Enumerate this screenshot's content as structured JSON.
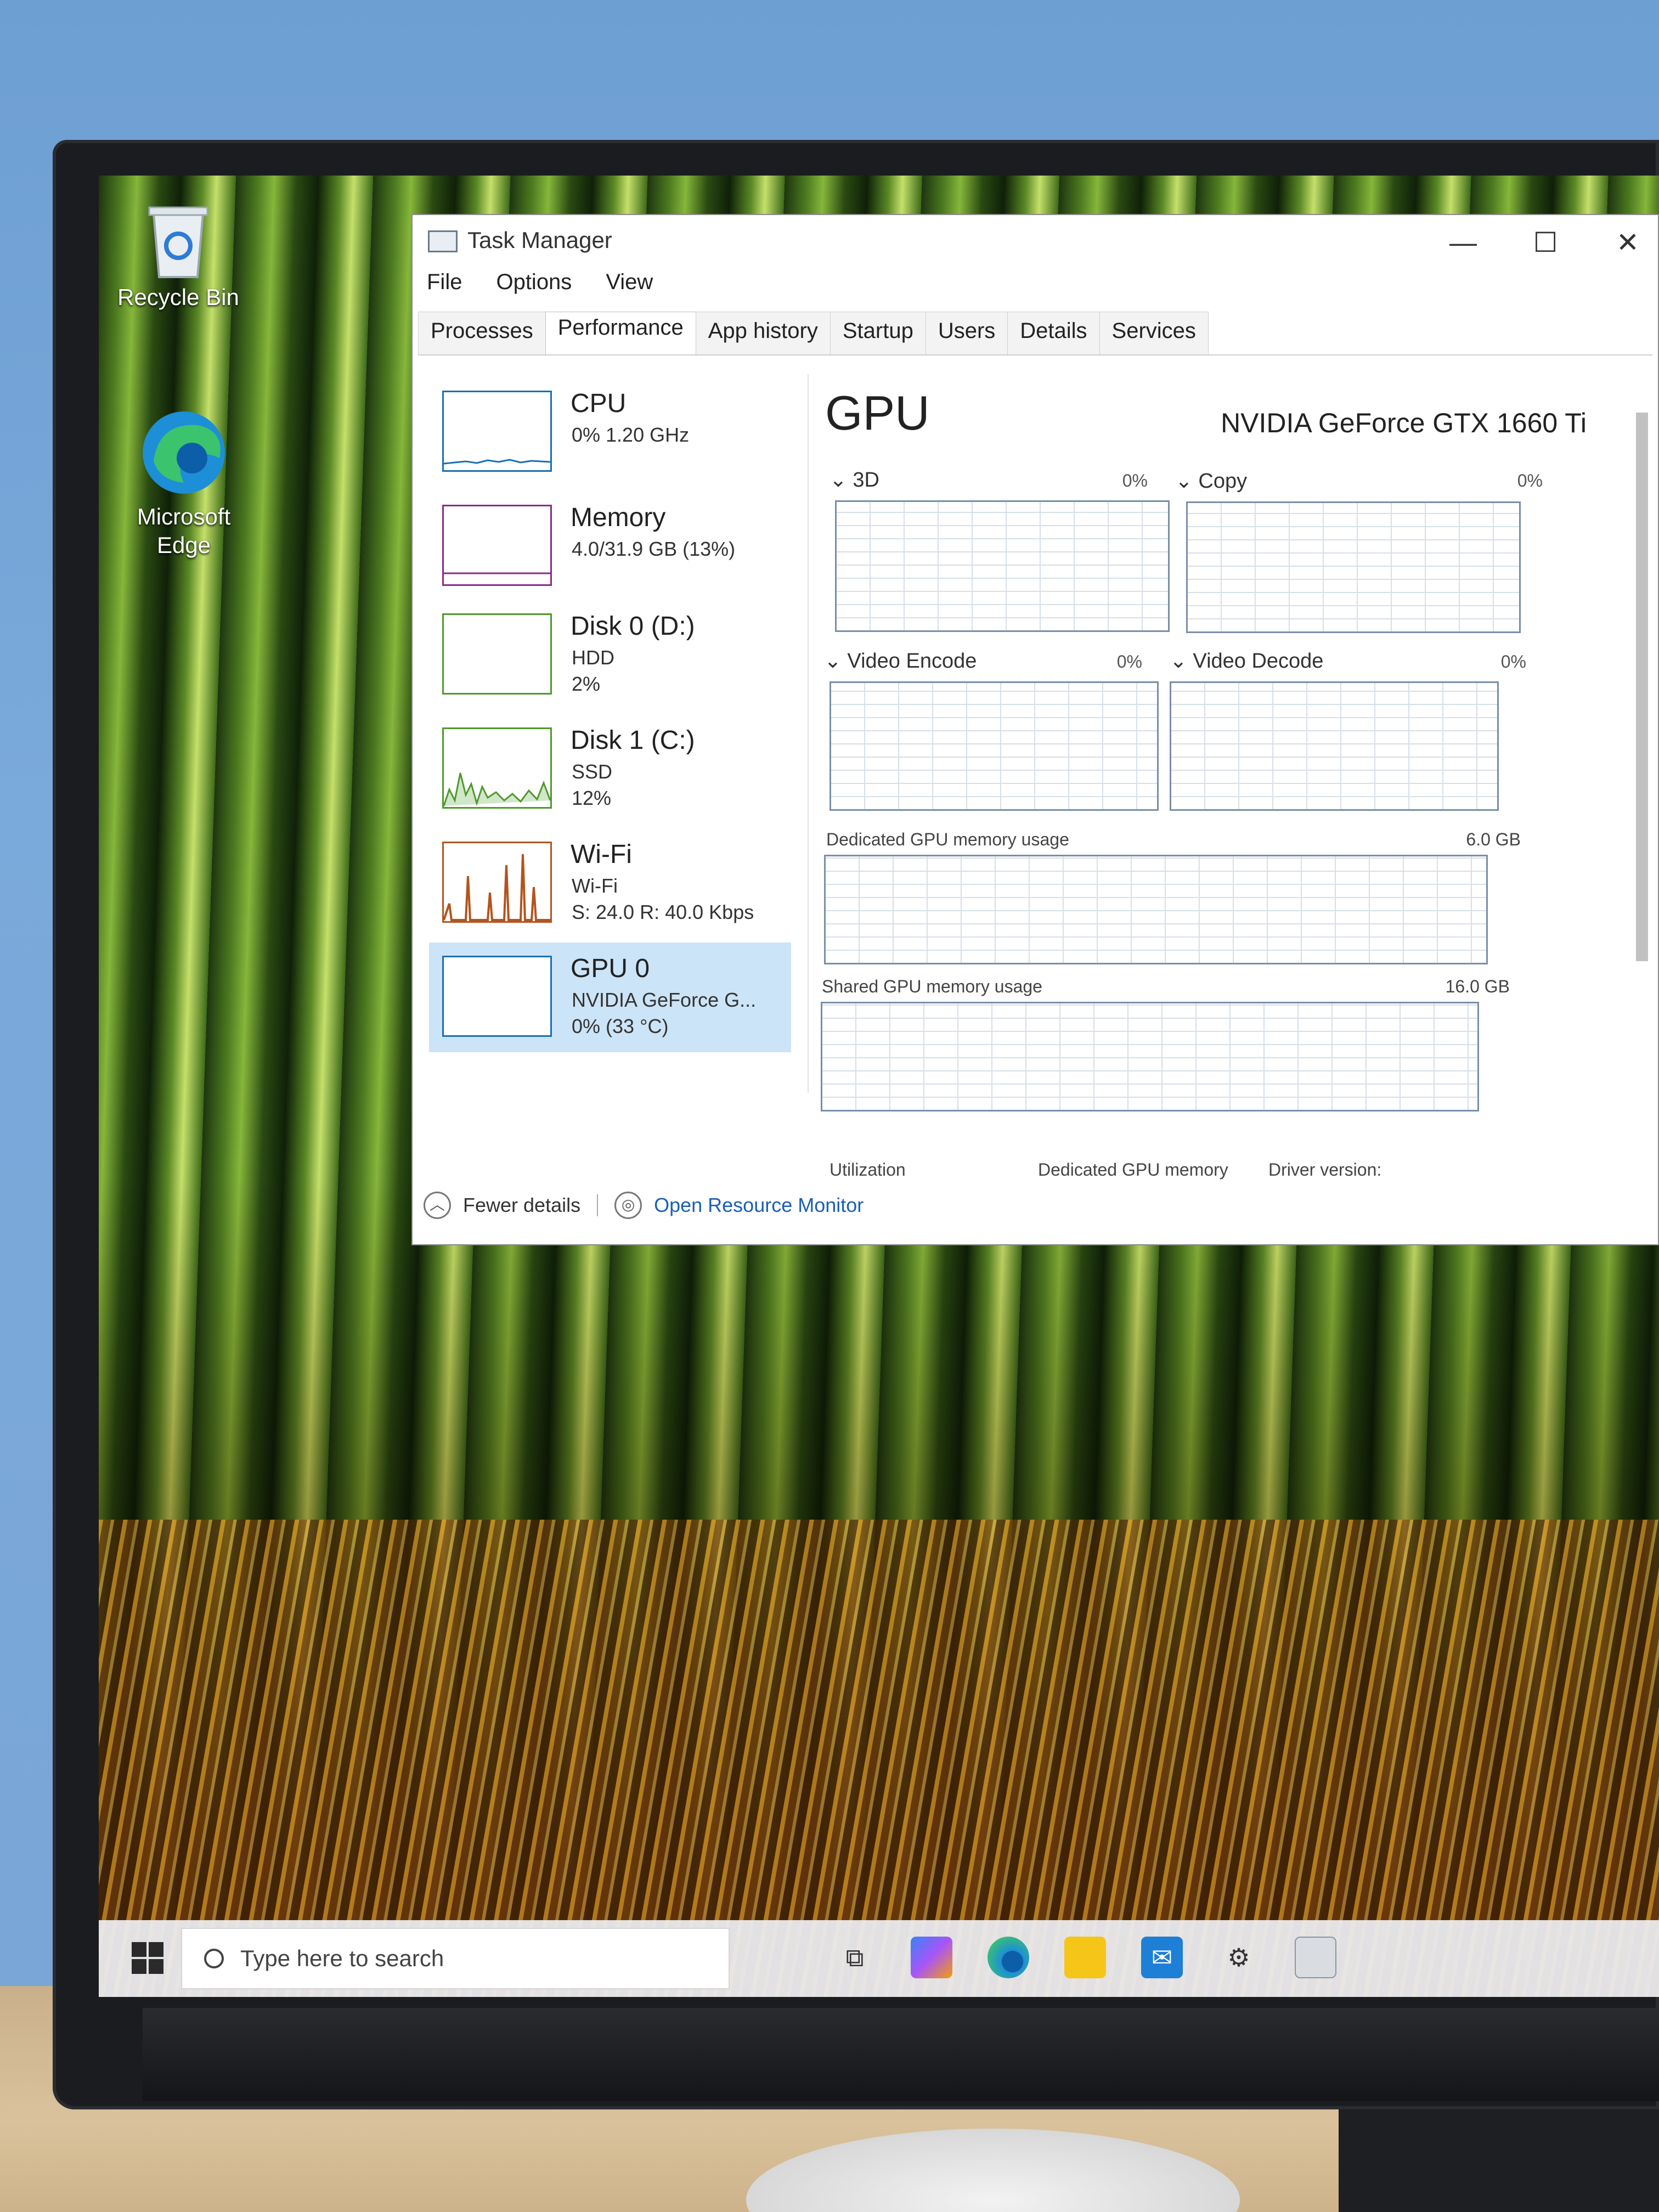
{
  "desktop": {
    "icons": [
      {
        "label": "Recycle Bin"
      },
      {
        "label": "Microsoft Edge"
      }
    ]
  },
  "task_manager": {
    "title": "Task Manager",
    "window_controls": {
      "minimize": "—",
      "maximize": "☐",
      "close": "✕"
    },
    "menu": [
      "File",
      "Options",
      "View"
    ],
    "tabs": [
      "Processes",
      "Performance",
      "App history",
      "Startup",
      "Users",
      "Details",
      "Services"
    ],
    "active_tab": "Performance",
    "sidebar": [
      {
        "name": "CPU",
        "line1": "0% 1.20 GHz",
        "line2": "",
        "color": "#1a6fb3"
      },
      {
        "name": "Memory",
        "line1": "4.0/31.9 GB (13%)",
        "line2": "",
        "color": "#8b2a8b"
      },
      {
        "name": "Disk 0 (D:)",
        "line1": "HDD",
        "line2": "2%",
        "color": "#4d9a2a"
      },
      {
        "name": "Disk 1 (C:)",
        "line1": "SSD",
        "line2": "12%",
        "color": "#4d9a2a"
      },
      {
        "name": "Wi-Fi",
        "line1": "Wi-Fi",
        "line2": "S: 24.0 R: 40.0 Kbps",
        "color": "#b3541e"
      },
      {
        "name": "GPU 0",
        "line1": "NVIDIA GeForce G...",
        "line2": "0% (33 °C)",
        "color": "#1a6fb3",
        "selected": true
      }
    ],
    "gpu": {
      "title": "GPU",
      "model": "NVIDIA GeForce GTX 1660 Ti",
      "engines": [
        {
          "label": "3D",
          "value": "0%"
        },
        {
          "label": "Copy",
          "value": "0%"
        },
        {
          "label": "Video Encode",
          "value": "0%"
        },
        {
          "label": "Video Decode",
          "value": "0%"
        }
      ],
      "dedicated_label": "Dedicated GPU memory usage",
      "dedicated_value": "6.0 GB",
      "shared_label": "Shared GPU memory usage",
      "shared_value": "16.0 GB",
      "stats": [
        "Utilization",
        "Dedicated GPU memory",
        "Driver version:"
      ]
    },
    "footer": {
      "fewer": "Fewer details",
      "resource_monitor": "Open Resource Monitor"
    }
  },
  "taskbar": {
    "search_placeholder": "Type here to search",
    "icons": [
      "task-view",
      "copilot",
      "edge",
      "file-explorer",
      "mail",
      "settings",
      "task-manager"
    ]
  }
}
